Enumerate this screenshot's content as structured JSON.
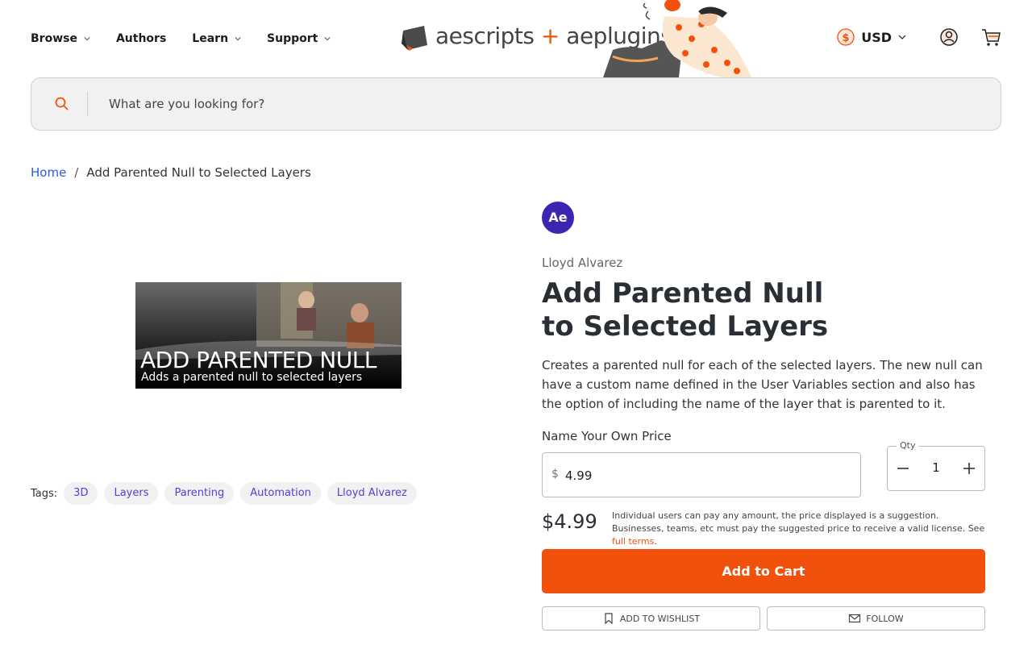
{
  "nav": {
    "items": [
      {
        "label": "Browse",
        "has_dropdown": true
      },
      {
        "label": "Authors",
        "has_dropdown": false
      },
      {
        "label": "Learn",
        "has_dropdown": true
      },
      {
        "label": "Support",
        "has_dropdown": true
      }
    ]
  },
  "logo": {
    "left": "aescripts",
    "plus": "+",
    "right": "aeplugins"
  },
  "header_right": {
    "currency": "USD"
  },
  "search": {
    "placeholder": "What are you looking for?"
  },
  "breadcrumb": {
    "home": "Home",
    "separator": "/",
    "current": "Add Parented Null to Selected Layers"
  },
  "product_image": {
    "caption_title": "ADD PARENTED NULL",
    "caption_sub": "Adds a parented null to selected layers"
  },
  "tags": {
    "label": "Tags:",
    "items": [
      "3D",
      "Layers",
      "Parenting",
      "Automation",
      "Lloyd Alvarez"
    ]
  },
  "product": {
    "app_badge": "Ae",
    "author": "Lloyd Alvarez",
    "title": "Add Parented Null to Selected Layers",
    "description": "Creates a parented null for each of the selected layers. The new null can have a custom name defined in the User Variables section and also has the option of including the name of the layer that is parented to it.",
    "nyop_label": "Name Your Own Price",
    "currency_symbol": "$",
    "price_value": "4.99",
    "qty_label": "Qty",
    "qty_value": "1",
    "display_price": "$4.99",
    "terms_text": "Individual users can pay any amount, the price displayed is a suggestion. Businesses, teams, etc must pay the suggested price to receive a valid license. See ",
    "terms_link": "full terms",
    "terms_end": ".",
    "add_to_cart": "Add to Cart",
    "wishlist": "ADD TO WISHLIST",
    "follow": "FOLLOW"
  },
  "colors": {
    "accent": "#f2510d",
    "badge": "#3a26b0",
    "tag_text": "#5b3bd8"
  }
}
